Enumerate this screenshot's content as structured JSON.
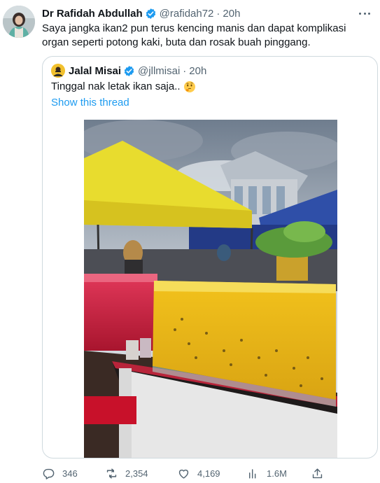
{
  "tweet": {
    "author_name": "Dr Rafidah Abdullah",
    "author_handle": "@rafidah72",
    "separator": "·",
    "timestamp": "20h",
    "text": "Saya jangka ikan2 pun terus kencing manis dan dapat komplikasi organ seperti potong kaki, buta dan rosak buah pinggang.",
    "icons": {
      "verified": "verified-badge-icon",
      "more": "more-options-icon"
    }
  },
  "quoted": {
    "author_name": "Jalal Misai",
    "author_handle": "@jllmisai",
    "separator": "·",
    "timestamp": "20h",
    "text": "Tinggal nak letak ikan saja..",
    "emoji": "thinking-face-emoji",
    "show_thread_label": "Show this thread"
  },
  "actions": {
    "replies": "346",
    "retweets": "2,354",
    "likes": "4,169",
    "views": "1.6M",
    "icons": [
      "reply-icon",
      "retweet-icon",
      "like-icon",
      "views-icon",
      "share-icon"
    ]
  },
  "colors": {
    "text": "#0f1419",
    "secondary": "#536471",
    "link": "#1d9bf0",
    "border": "#cfd9de"
  }
}
